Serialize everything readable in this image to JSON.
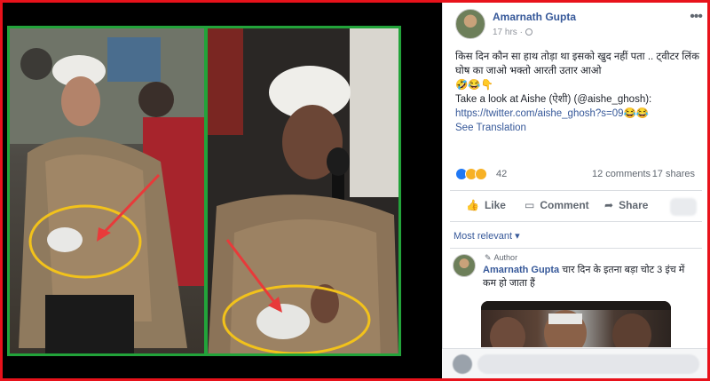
{
  "post": {
    "author": "Amarnath Gupta",
    "time": "17 hrs ·",
    "more": "•••",
    "text_line1": "किस दिन कौन सा हाथ तोड़ा था इसको खुद नहीं पता .. ट्वीटर लिंक घोष का जाओ भक्तो आरती उतार आओ",
    "text_emojis": "🤣😂👇",
    "text_line2": "Take a look at Aishe (ऐशी) (@aishe_ghosh):",
    "link": "https://twitter.com/aishe_ghosh?s=09",
    "link_emojis": "😂😂",
    "see_translation": "See Translation"
  },
  "reactions": {
    "icons": [
      "like-icon",
      "haha-icon",
      "wow-icon"
    ],
    "count": "42",
    "comments": "12 comments",
    "shares": "17 shares"
  },
  "actions": {
    "like": "Like",
    "comment": "Comment",
    "share": "Share"
  },
  "comments_section": {
    "sort": "Most relevant ▾",
    "comment": {
      "badge": "Author",
      "author": "Amarnath Gupta",
      "text": "चार दिन के इतना बड़ा चोट 3 इंच में कम हो जाता हैं"
    }
  },
  "colors": {
    "frame": "#e8121b",
    "photo_border": "#22a33a",
    "fb_link": "#365899",
    "circle": "#f2c21b",
    "arrow": "#e83a3a"
  }
}
